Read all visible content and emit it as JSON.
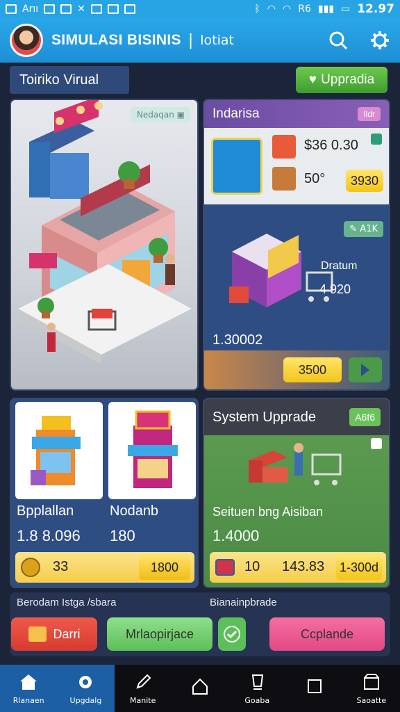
{
  "status": {
    "left_text": "Arıı",
    "time": "12.97",
    "net": "R6"
  },
  "app": {
    "title": "SIMULASI BISINIS",
    "separator": "|",
    "subtitle": "lotiat"
  },
  "header": {
    "section_title": "Toiriko Virual",
    "upgrade_label": "Uppradia"
  },
  "shop": {
    "tag": "Nedaqan"
  },
  "industry": {
    "title": "Indarisa",
    "chip": "Ildr",
    "price": "$36 0.30",
    "count": "50°",
    "count_btn": "3930",
    "tag": "A1K",
    "item_name": "Dratum",
    "item_value": "4 920",
    "total": "1.30002",
    "buy_btn": "3500"
  },
  "cards": [
    {
      "name": "Bpplallan",
      "value": "1.8 8.096"
    },
    {
      "name": "Nodanb",
      "value": "180"
    }
  ],
  "coin_row": {
    "value": "33",
    "btn": "1800"
  },
  "system": {
    "title": "System Upprade",
    "chip": "A6f6",
    "desc": "Seituen bng Aisiban",
    "value": "1.4000",
    "count": "10",
    "amount": "143.83",
    "btn": "1-300d"
  },
  "lower": {
    "left_label": "Berodam Istga /sbara",
    "right_label": "Bianainpbrade",
    "dark_btn": "Darri",
    "market_btn": "Mrlaopirjace",
    "pink_btn": "Ccplande"
  },
  "nav": [
    {
      "label": "Rlanaen",
      "icon": "home-icon"
    },
    {
      "label": "Upgdalg",
      "icon": "gear-icon"
    },
    {
      "label": "Manite",
      "icon": "pencil-icon"
    },
    {
      "label": "",
      "icon": "house-outline-icon"
    },
    {
      "label": "Goaba",
      "icon": "cup-icon"
    },
    {
      "label": "",
      "icon": "square-icon"
    },
    {
      "label": "Saoatte",
      "icon": "store-icon"
    }
  ]
}
